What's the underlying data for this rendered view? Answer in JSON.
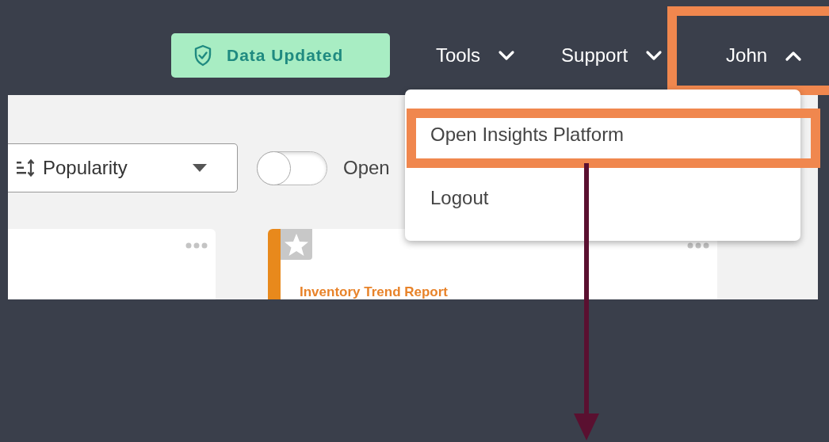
{
  "header": {
    "status_badge": {
      "label": "Data Updated"
    },
    "nav": [
      {
        "label": "Tools",
        "expanded": false,
        "highlighted": false
      },
      {
        "label": "Support",
        "expanded": false,
        "highlighted": false
      },
      {
        "label": "John",
        "expanded": true,
        "highlighted": true
      }
    ]
  },
  "toolbar": {
    "sort": {
      "value": "Popularity"
    },
    "toggle": {
      "label": "Open",
      "on": false
    }
  },
  "cards": [
    {
      "kind": "plain"
    },
    {
      "kind": "report",
      "title": "Inventory Trend Report",
      "starred": false
    }
  ],
  "user_menu": {
    "items": [
      {
        "label": "Open Insights Platform",
        "highlighted": true
      },
      {
        "label": "Logout",
        "highlighted": false
      }
    ]
  }
}
